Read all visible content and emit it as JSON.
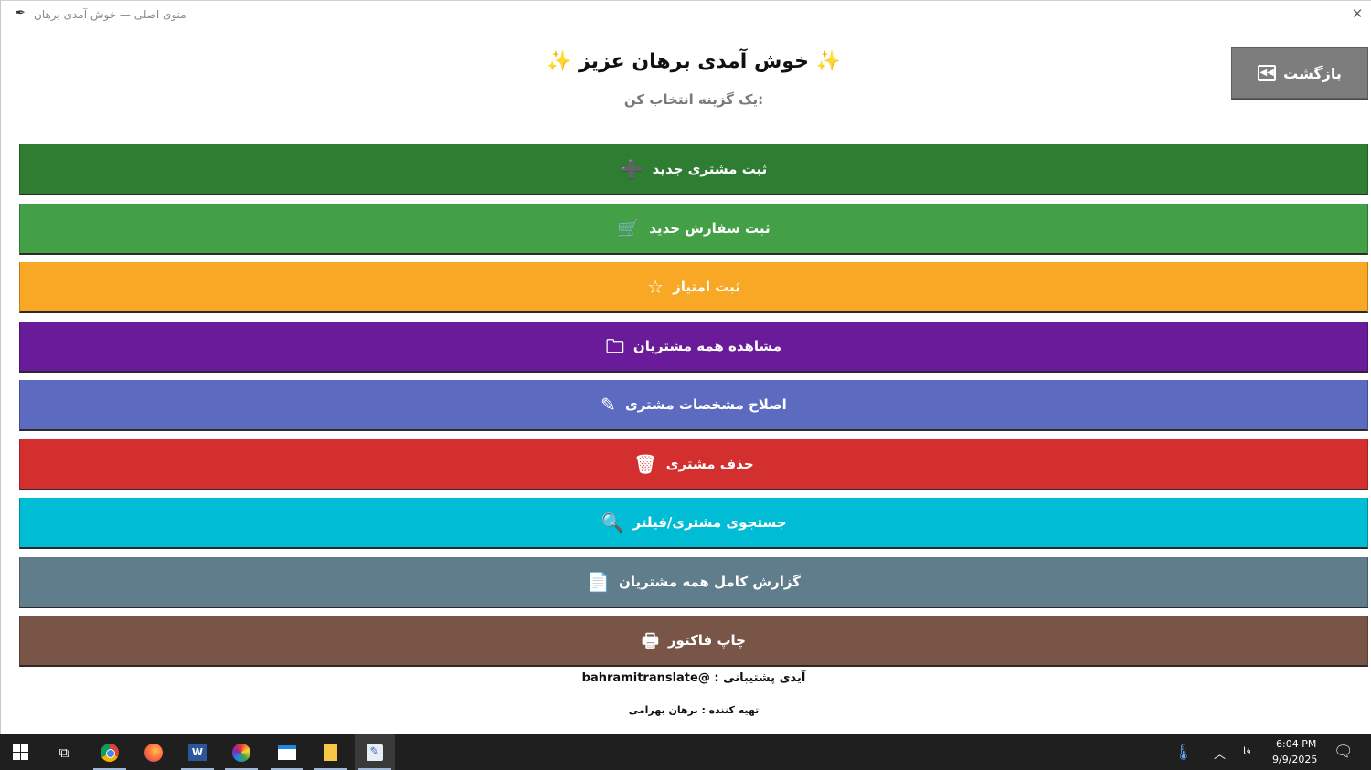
{
  "window": {
    "title": "منوی اصلی — خوش آمدی برهان",
    "close_glyph": "✕"
  },
  "header": {
    "heading": "✨ خوش آمدی برهان عزیز ✨",
    "subtitle": ":یک گزینه انتخاب کن"
  },
  "back_button": {
    "label": "بازگشت",
    "icon": "back-icon"
  },
  "menu": {
    "items": [
      {
        "name": "register-customer-button",
        "label": "ثبت مشتری جدید",
        "icon": "plus-icon",
        "glyph": "➕",
        "color": "#2e7d32"
      },
      {
        "name": "register-order-button",
        "label": "ثبت سفارش جدید",
        "icon": "cart-icon",
        "glyph": "🛒",
        "color": "#43a047"
      },
      {
        "name": "register-points-button",
        "label": "ثبت امتیاز",
        "icon": "star-icon",
        "glyph": "☆",
        "color": "#f9a825"
      },
      {
        "name": "view-all-customers-button",
        "label": "مشاهده همه مشتریان",
        "icon": "folder-icon",
        "glyph": "🗀",
        "color": "#6a1b9a"
      },
      {
        "name": "edit-customer-button",
        "label": "اصلاح مشخصات مشتری",
        "icon": "pencil-icon",
        "glyph": "✎",
        "color": "#5c6bc0"
      },
      {
        "name": "delete-customer-button",
        "label": "حذف مشتری",
        "icon": "trash-icon",
        "glyph": "🗑",
        "color": "#d32f2f"
      },
      {
        "name": "search-customer-button",
        "label": "جستجوی مشتری/فیلتر",
        "icon": "search-icon",
        "glyph": "🔍",
        "color": "#00bcd4"
      },
      {
        "name": "full-report-button",
        "label": "گزارش کامل همه مشتریان",
        "icon": "report-icon",
        "glyph": "📄",
        "color": "#607d8b"
      },
      {
        "name": "print-invoice-button",
        "label": "چاپ فاکتور",
        "icon": "printer-icon",
        "glyph": "🖶",
        "color": "#795548"
      }
    ]
  },
  "footer": {
    "support": "آیدی پشتیبانی : @bahramitranslate",
    "author": "تهیه کننده : برهان بهرامی"
  },
  "taskbar": {
    "lang": "فا",
    "time": "6:04 PM",
    "date": "9/9/2025"
  }
}
